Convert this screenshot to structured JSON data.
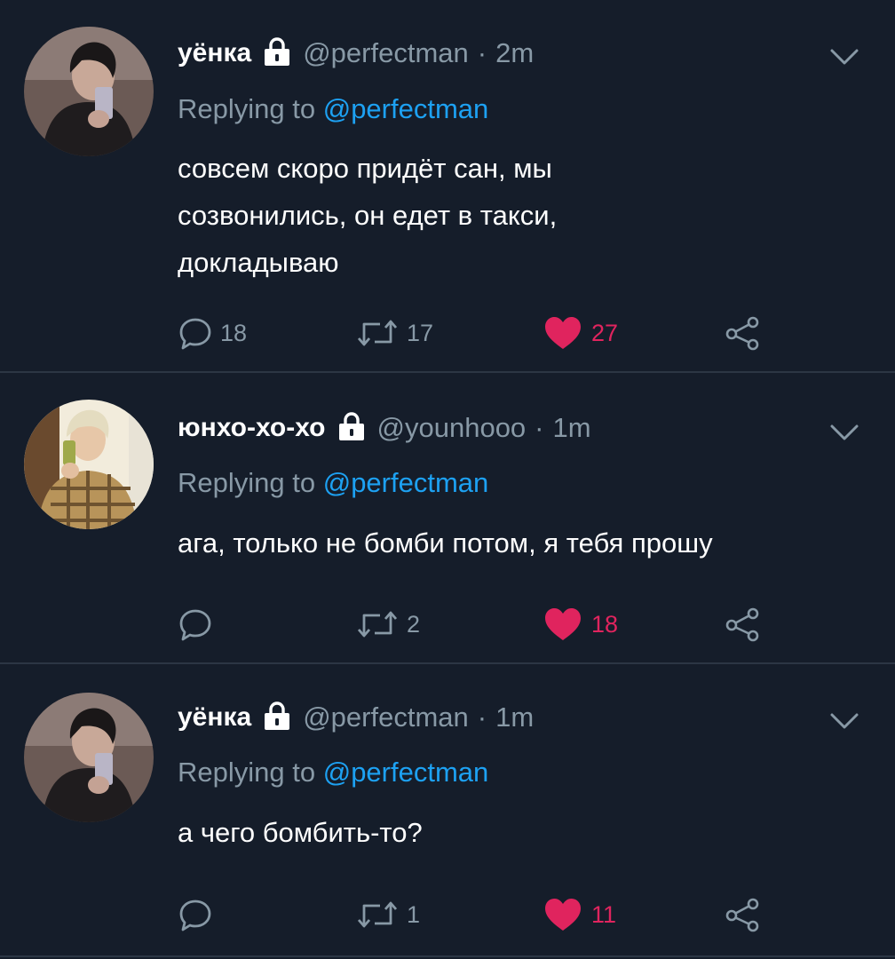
{
  "colors": {
    "background": "#151d2a",
    "divider": "#2c3644",
    "secondary_text": "#8899a6",
    "mention": "#1da1f2",
    "like": "#e0245e"
  },
  "icons": {
    "lock": "lock-icon",
    "chevron": "chevron-down-icon",
    "reply": "reply-icon",
    "retweet": "retweet-icon",
    "like": "heart-icon",
    "share": "share-icon"
  },
  "tweets": [
    {
      "name": "уёнка",
      "handle": "@perfectman",
      "dot": "·",
      "time": "2m",
      "replying_prefix": "Replying to",
      "replying_to": "@perfectman",
      "lines": [
        "совсем скоро придёт сан, мы",
        "созвонились, он едет в такси,",
        "докладываю"
      ],
      "replies": "18",
      "retweets": "17",
      "likes": "27"
    },
    {
      "name": "юнхо-хо-хо",
      "handle": "@younhooo",
      "dot": "·",
      "time": "1m",
      "replying_prefix": "Replying to",
      "replying_to": "@perfectman",
      "lines": [
        "ага, только не бомби потом, я тебя прошу"
      ],
      "replies": "",
      "retweets": "2",
      "likes": "18"
    },
    {
      "name": "уёнка",
      "handle": "@perfectman",
      "dot": "·",
      "time": "1m",
      "replying_prefix": "Replying to",
      "replying_to": "@perfectman",
      "lines": [
        "а чего бомбить-то?"
      ],
      "replies": "",
      "retweets": "1",
      "likes": "11"
    }
  ]
}
